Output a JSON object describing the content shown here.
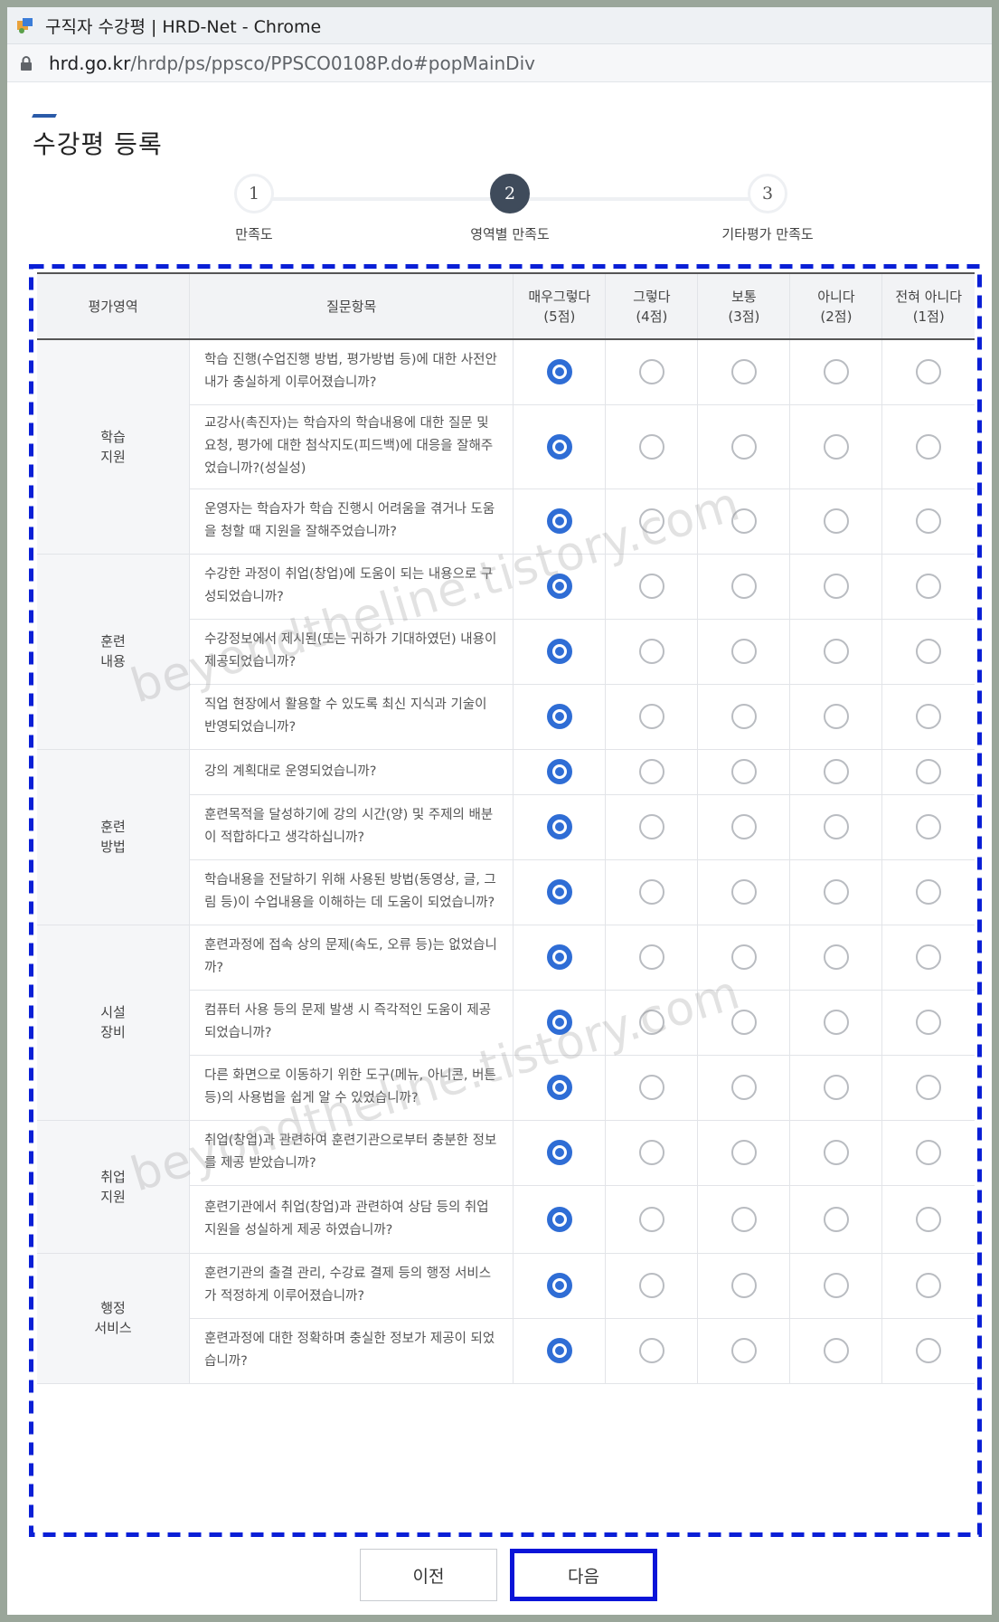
{
  "browser": {
    "title": "구직자 수강평 | HRD-Net - Chrome",
    "url_host": "hrd.go.kr",
    "url_path": "/hrdp/ps/ppsco/PPSCO0108P.do#popMainDiv"
  },
  "page": {
    "title": "수강평 등록"
  },
  "steps": [
    {
      "number": "1",
      "label": "만족도"
    },
    {
      "number": "2",
      "label": "영역별 만족도"
    },
    {
      "number": "3",
      "label": "기타평가 만족도"
    }
  ],
  "table": {
    "headers": {
      "area": "평가영역",
      "question": "질문항목",
      "opt1_a": "매우그렇다",
      "opt1_b": "(5점)",
      "opt2_a": "그렇다",
      "opt2_b": "(4점)",
      "opt3_a": "보통",
      "opt3_b": "(3점)",
      "opt4_a": "아니다",
      "opt4_b": "(2점)",
      "opt5_a": "전혀 아니다",
      "opt5_b": "(1점)"
    },
    "groups": [
      {
        "area_a": "학습",
        "area_b": "지원",
        "q": [
          "학습 진행(수업진행 방법, 평가방법 등)에 대한 사전안내가 충실하게 이루어졌습니까?",
          "교강사(촉진자)는 학습자의 학습내용에 대한 질문 및 요청, 평가에 대한 첨삭지도(피드백)에 대응을 잘해주었습니까?(성실성)",
          "운영자는 학습자가 학습 진행시 어려움을 겪거나 도움을 청할 때 지원을 잘해주었습니까?"
        ]
      },
      {
        "area_a": "훈련",
        "area_b": "내용",
        "q": [
          "수강한 과정이 취업(창업)에 도움이 되는 내용으로 구성되었습니까?",
          "수강정보에서 제시된(또는 귀하가 기대하였던) 내용이 제공되었습니까?",
          "직업 현장에서 활용할 수 있도록 최신 지식과 기술이 반영되었습니까?"
        ]
      },
      {
        "area_a": "훈련",
        "area_b": "방법",
        "q": [
          "강의 계획대로 운영되었습니까?",
          "훈련목적을 달성하기에 강의 시간(양) 및 주제의 배분이 적합하다고 생각하십니까?",
          "학습내용을 전달하기 위해 사용된 방법(동영상, 글, 그림 등)이 수업내용을 이해하는 데 도움이 되었습니까?"
        ]
      },
      {
        "area_a": "시설",
        "area_b": "장비",
        "q": [
          "훈련과정에 접속 상의 문제(속도, 오류 등)는 없었습니까?",
          "컴퓨터 사용 등의 문제 발생 시 즉각적인 도움이 제공 되었습니까?",
          "다른 화면으로 이동하기 위한 도구(메뉴, 아니콘, 버튼 등)의 사용법을 쉽게 알 수 있었습니까?"
        ]
      },
      {
        "area_a": "취업",
        "area_b": "지원",
        "q": [
          "취업(창업)과 관련하여 훈련기관으로부터 충분한 정보를 제공 받았습니까?",
          "훈련기관에서 취업(창업)과 관련하여 상담 등의 취업 지원을 성실하게 제공 하였습니까?"
        ]
      },
      {
        "area_a": "행정",
        "area_b": "서비스",
        "q": [
          "훈련기관의 출결 관리, 수강료 결제 등의 행정 서비스가 적정하게 이루어졌습니까?",
          "훈련과정에 대한 정확하며 충실한 정보가 제공이 되었습니까?"
        ]
      }
    ],
    "selected_option": "매우그렇다"
  },
  "buttons": {
    "prev": "이전",
    "next": "다음"
  },
  "watermark": "beyondtheline.tistory.com",
  "colors": {
    "accent": "#2f6dd5",
    "highlight": "#0a14d8"
  }
}
